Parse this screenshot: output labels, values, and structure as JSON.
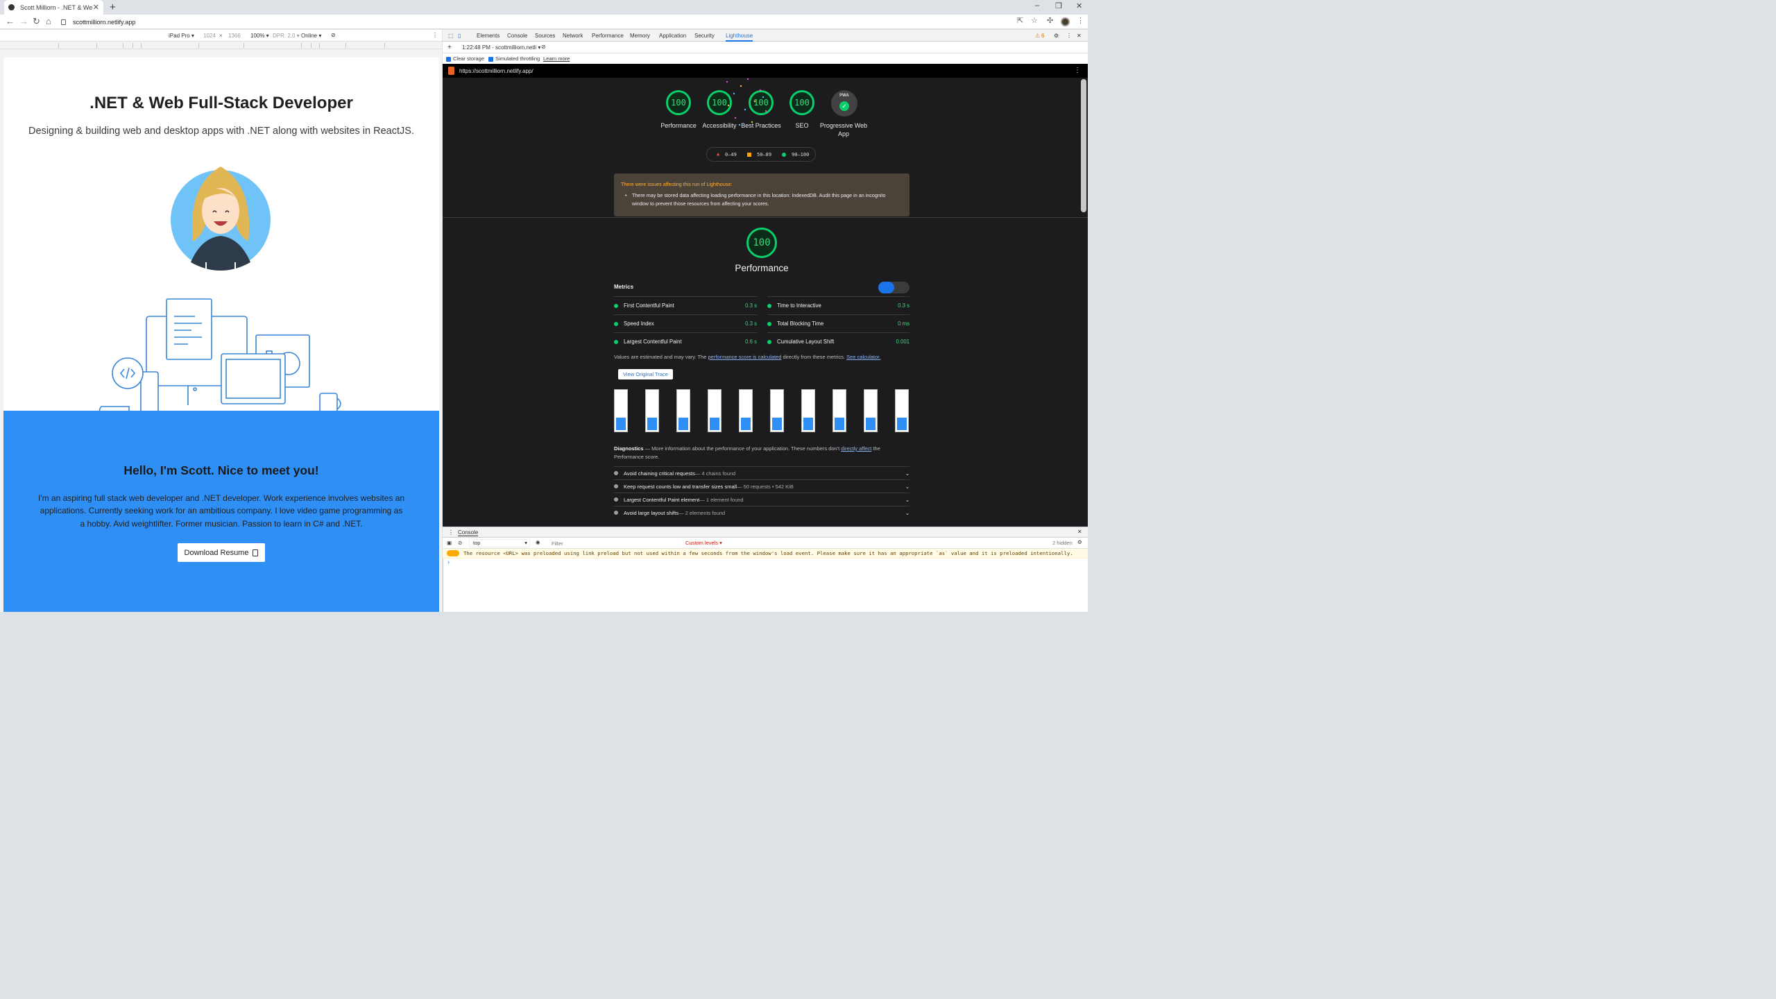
{
  "browser": {
    "tab_title": "Scott Milliorn - .NET & Web Full-",
    "tab_close": "✕",
    "new_tab": "+",
    "url": "scottmilliorn.netlify.app",
    "window": {
      "minimize": "–",
      "restore": "❐",
      "close": "✕"
    }
  },
  "device_toolbar": {
    "device": "iPad Pro ▾",
    "width": "1024",
    "times": "×",
    "height": "1366",
    "zoom": "100% ▾",
    "dpr": "DPR: 2.0 ▾",
    "network": "Online ▾",
    "more": "⋮"
  },
  "page": {
    "title": ".NET & Web Full-Stack Developer",
    "subtitle": "Designing & building web and desktop apps with .NET along with websites in ReactJS.",
    "hello": "Hello, I'm Scott. Nice to meet you!",
    "bio": "I'm an aspiring full stack web developer and .NET developer. Work experience involves websites an applications. Currently seeking work for an ambitious company. I love video game programming as a hobby. Avid weightlifter. Former musician. Passion to learn in C# and .NET.",
    "resume_button": "Download Resume"
  },
  "devtools": {
    "tabs": [
      "Elements",
      "Console",
      "Sources",
      "Network",
      "Performance",
      "Memory",
      "Application",
      "Security",
      "Lighthouse"
    ],
    "active_tab": "Lighthouse",
    "warning_count": "6",
    "lighthouse_run": "1:22:48 PM - scottmilliorn.netli ▾",
    "add": "+",
    "clear_storage": "Clear storage",
    "simulated_throttling": "Simulated throttling",
    "learn_more": "Learn more"
  },
  "report": {
    "url": "https://scottmilliorn.netlify.app/",
    "menu": "⋮",
    "gauges": [
      {
        "score": "100",
        "label": "Performance"
      },
      {
        "score": "100",
        "label": "Accessibility"
      },
      {
        "score": "100",
        "label": "Best Practices"
      },
      {
        "score": "100",
        "label": "SEO"
      }
    ],
    "pwa": {
      "badge": "PWA",
      "label": "Progressive Web App"
    },
    "legend": {
      "fail": "0–49",
      "average": "50–89",
      "pass": "90–100"
    },
    "warning": {
      "title": "There were issues affecting this run of Lighthouse:",
      "item": "There may be stored data affecting loading performance in this location: IndexedDB. Audit this page in an incognito window to prevent those resources from affecting your scores."
    },
    "performance": {
      "score": "100",
      "title": "Performance"
    },
    "metrics_heading": "Metrics",
    "metrics_left": [
      {
        "name": "First Contentful Paint",
        "value": "0.3 s"
      },
      {
        "name": "Speed Index",
        "value": "0.3 s"
      },
      {
        "name": "Largest Contentful Paint",
        "value": "0.6 s"
      }
    ],
    "metrics_right": [
      {
        "name": "Time to Interactive",
        "value": "0.3 s"
      },
      {
        "name": "Total Blocking Time",
        "value": "0 ms"
      },
      {
        "name": "Cumulative Layout Shift",
        "value": "0.001"
      }
    ],
    "note": {
      "prefix": "Values are estimated and may vary. The ",
      "link": "performance score is calculated",
      "middle": " directly from these metrics. ",
      "calc": "See calculator."
    },
    "trace_button": "View Original Trace",
    "diagnostics": {
      "title": "Diagnostics",
      "text": " — More information about the performance of your application. These numbers don't ",
      "link": "directly affect",
      "end": " the Performance score."
    },
    "audits": [
      {
        "name": "Avoid chaining critical requests",
        "detail": " — 4 chains found"
      },
      {
        "name": "Keep request counts low and transfer sizes small",
        "detail": " — 50 requests • 542 KiB"
      },
      {
        "name": "Largest Contentful Paint element",
        "detail": " — 1 element found"
      },
      {
        "name": "Avoid large layout shifts",
        "detail": " — 2 elements found"
      }
    ]
  },
  "console": {
    "title": "Console",
    "context": "top",
    "filter_placeholder": "Filter",
    "levels": "Custom levels ▾",
    "hidden": "2 hidden",
    "message": "The resource <URL> was preloaded using link preload but not used within a few seconds from the window's load event. Please make sure it has an appropriate `as` value and it is preloaded intentionally.",
    "prompt": "›"
  }
}
